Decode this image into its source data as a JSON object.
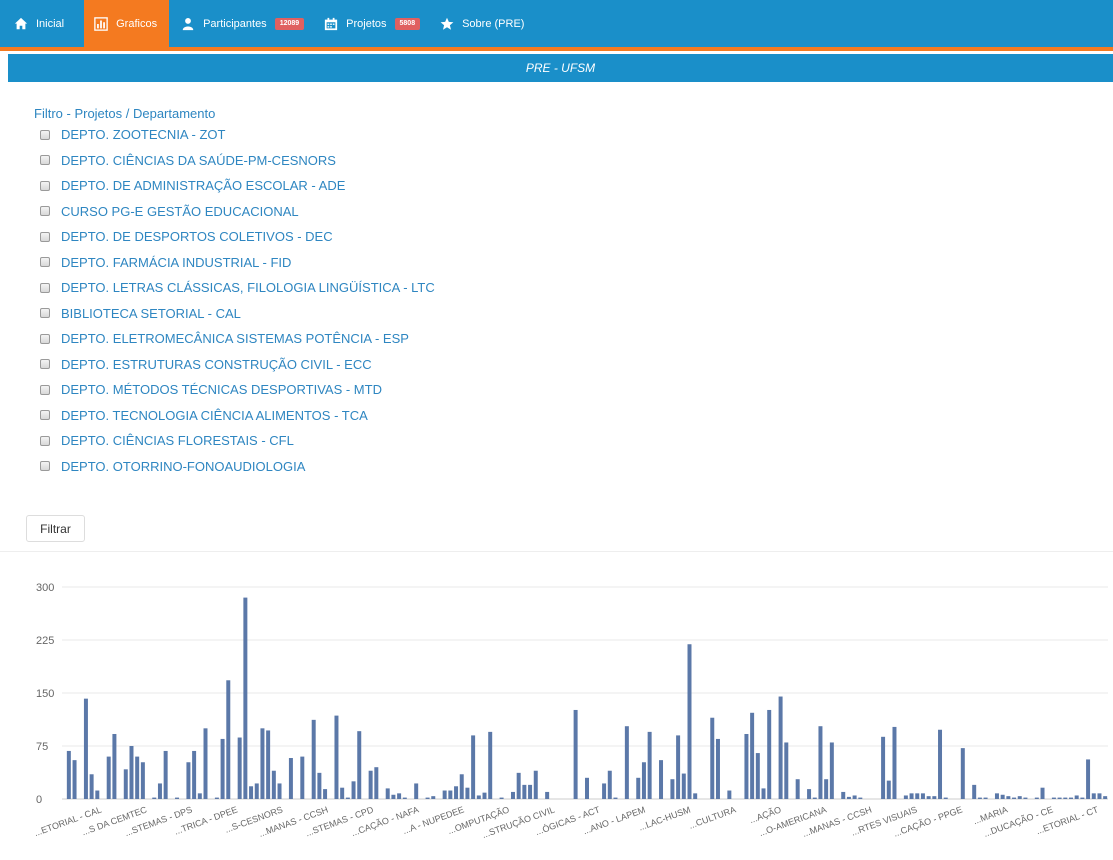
{
  "navbar": {
    "items": [
      {
        "label": "Inicial",
        "icon": "home-icon",
        "active": false
      },
      {
        "label": "Graficos",
        "icon": "bar-chart-icon",
        "active": true
      },
      {
        "label": "Participantes",
        "icon": "user-icon",
        "badge": "12089",
        "active": false
      },
      {
        "label": "Projetos",
        "icon": "calendar-icon",
        "badge": "5808",
        "active": false
      },
      {
        "label": "Sobre (PRE)",
        "icon": "star-icon",
        "active": false
      }
    ],
    "colors": {
      "bar": "#1a8fc9",
      "active": "#f47a20",
      "badge": "#e06060"
    }
  },
  "subheader": {
    "title": "PRE - UFSM"
  },
  "filter": {
    "title": "Filtro - Projetos / Departamento",
    "departments": [
      "DEPTO. ZOOTECNIA - ZOT",
      "DEPTO. CIÊNCIAS DA SAÚDE-PM-CESNORS",
      "DEPTO. DE ADMINISTRAÇÃO ESCOLAR - ADE",
      "CURSO PG-E GESTÃO EDUCACIONAL",
      "DEPTO. DE DESPORTOS COLETIVOS - DEC",
      "DEPTO. FARMÁCIA INDUSTRIAL - FID",
      "DEPTO. LETRAS CLÁSSICAS, FILOLOGIA LINGÜÍSTICA - LTC",
      "BIBLIOTECA SETORIAL - CAL",
      "DEPTO. ELETROMECÂNICA SISTEMAS POTÊNCIA - ESP",
      "DEPTO. ESTRUTURAS CONSTRUÇÃO CIVIL - ECC",
      "DEPTO. MÉTODOS TÉCNICAS DESPORTIVAS - MTD",
      "DEPTO. TECNOLOGIA CIÊNCIA ALIMENTOS - TCA",
      "DEPTO. CIÊNCIAS FLORESTAIS - CFL",
      "DEPTO. OTORRINO-FONOAUDIOLOGIA"
    ],
    "button_label": "Filtrar"
  },
  "chart_data": {
    "type": "bar",
    "ylim": [
      0,
      300
    ],
    "yticks": [
      0,
      75,
      150,
      225,
      300
    ],
    "grid": true,
    "bar_color": "#5b78a8",
    "values": [
      68,
      55,
      0,
      142,
      35,
      12,
      0,
      60,
      92,
      0,
      42,
      75,
      60,
      52,
      0,
      2,
      22,
      68,
      0,
      2,
      0,
      52,
      68,
      8,
      100,
      0,
      2,
      85,
      168,
      0,
      87,
      285,
      18,
      22,
      100,
      97,
      40,
      22,
      0,
      58,
      0,
      60,
      0,
      112,
      37,
      14,
      0,
      118,
      16,
      2,
      25,
      96,
      0,
      40,
      45,
      0,
      15,
      6,
      8,
      2,
      0,
      22,
      0,
      2,
      4,
      0,
      12,
      12,
      18,
      35,
      16,
      90,
      5,
      9,
      95,
      0,
      2,
      0,
      10,
      37,
      20,
      20,
      40,
      0,
      10,
      0,
      0,
      0,
      0,
      126,
      0,
      30,
      0,
      0,
      22,
      40,
      2,
      0,
      103,
      0,
      30,
      52,
      95,
      0,
      55,
      0,
      28,
      90,
      36,
      219,
      8,
      0,
      0,
      115,
      85,
      0,
      12,
      0,
      0,
      92,
      122,
      65,
      15,
      126,
      0,
      145,
      80,
      0,
      28,
      0,
      14,
      2,
      103,
      28,
      80,
      0,
      10,
      3,
      5,
      2,
      0,
      0,
      0,
      88,
      26,
      102,
      0,
      5,
      8,
      8,
      8,
      4,
      4,
      98,
      2,
      0,
      0,
      72,
      0,
      20,
      2,
      2,
      0,
      8,
      6,
      4,
      2,
      4,
      2,
      0,
      2,
      16,
      0,
      2,
      2,
      2,
      2,
      5,
      2,
      56,
      8,
      8,
      4
    ],
    "categories": [
      "...ETORIAL - CAL",
      "...S DA CEMTEC",
      "...STEMAS - DPS",
      "...TRICA - DPEE",
      "...S-CESNORS",
      "...MANAS - CCSH",
      "...STEMAS - CPD",
      "...CAÇÃO - NAFA",
      "...A - NUPEDEE",
      "...OMPUTAÇÃO",
      "...STRUÇÃO CIVIL",
      "...ÓGICAS - ACT",
      "...ANO - LAPEM",
      "...LAC-HUSM",
      "...CULTURA",
      "...AÇÃO",
      "...O-AMERICANA",
      "...MANAS - CCSH",
      "...RTES VISUAIS",
      "...CAÇÃO - PPGE",
      "...MARIA",
      "...DUCAÇÃO - CE",
      "...ETORIAL - CT"
    ]
  }
}
